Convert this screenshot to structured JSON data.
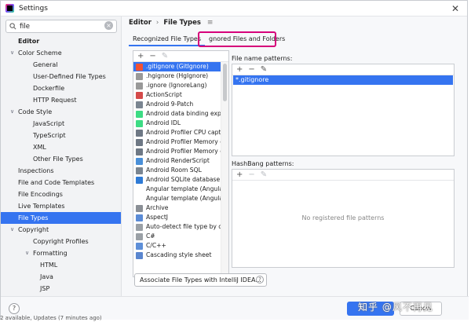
{
  "window": {
    "title": "Settings"
  },
  "search": {
    "value": "file"
  },
  "sidebar": {
    "items": [
      {
        "label": "Editor",
        "depth": 0,
        "bold": true,
        "chevron": ""
      },
      {
        "label": "Color Scheme",
        "depth": 1,
        "chevron": "∨"
      },
      {
        "label": "General",
        "depth": 2,
        "chevron": ""
      },
      {
        "label": "User-Defined File Types",
        "depth": 2,
        "chevron": ""
      },
      {
        "label": "Dockerfile",
        "depth": 2,
        "chevron": ""
      },
      {
        "label": "HTTP Request",
        "depth": 2,
        "chevron": ""
      },
      {
        "label": "Code Style",
        "depth": 1,
        "chevron": "∨"
      },
      {
        "label": "JavaScript",
        "depth": 2,
        "chevron": ""
      },
      {
        "label": "TypeScript",
        "depth": 2,
        "chevron": ""
      },
      {
        "label": "XML",
        "depth": 2,
        "chevron": ""
      },
      {
        "label": "Other File Types",
        "depth": 2,
        "chevron": ""
      },
      {
        "label": "Inspections",
        "depth": 1,
        "chevron": ""
      },
      {
        "label": "File and Code Templates",
        "depth": 1,
        "chevron": ""
      },
      {
        "label": "File Encodings",
        "depth": 1,
        "chevron": ""
      },
      {
        "label": "Live Templates",
        "depth": 1,
        "chevron": ""
      },
      {
        "label": "File Types",
        "depth": 1,
        "chevron": "",
        "selected": true
      },
      {
        "label": "Copyright",
        "depth": 1,
        "chevron": "∨"
      },
      {
        "label": "Copyright Profiles",
        "depth": 2,
        "chevron": ""
      },
      {
        "label": "Formatting",
        "depth": 2,
        "chevron": "∨"
      },
      {
        "label": "HTML",
        "depth": 3,
        "chevron": ""
      },
      {
        "label": "Java",
        "depth": 3,
        "chevron": ""
      },
      {
        "label": "JSP",
        "depth": 3,
        "chevron": ""
      }
    ]
  },
  "breadcrumb": {
    "parent": "Editor",
    "separator": "›",
    "current": "File Types",
    "menu_icon": "≡"
  },
  "tabs": [
    {
      "label": "Recognized File Types",
      "active": true
    },
    {
      "label": "gnored Files and Folders",
      "active": false
    }
  ],
  "file_types": {
    "toolbar": {
      "add": "+",
      "remove": "−",
      "edit": "✎"
    },
    "items": [
      {
        "label": ".gitignore (GitIgnore)",
        "icon": "git-icon",
        "color": "#f05133",
        "selected": true
      },
      {
        "label": ".hgignore (HgIgnore)",
        "icon": "hg-icon",
        "color": "#999999"
      },
      {
        "label": ".ignore (IgnoreLang)",
        "icon": "ignore-icon",
        "color": "#999999"
      },
      {
        "label": "ActionScript",
        "icon": "actionscript-icon",
        "color": "#d44a4a"
      },
      {
        "label": "Android 9-Patch",
        "icon": "image-icon",
        "color": "#7a8591"
      },
      {
        "label": "Android data binding express",
        "icon": "android-icon",
        "color": "#3ddc84"
      },
      {
        "label": "Android IDL",
        "icon": "android-icon",
        "color": "#3ddc84"
      },
      {
        "label": "Android Profiler CPU capture f",
        "icon": "profiler-icon",
        "color": "#6e7885"
      },
      {
        "label": "Android Profiler Memory capt",
        "icon": "profiler-icon",
        "color": "#6e7885"
      },
      {
        "label": "Android Profiler Memory capt",
        "icon": "profiler-icon",
        "color": "#6e7885"
      },
      {
        "label": "Android RenderScript",
        "icon": "renderscript-icon",
        "color": "#4a90d9"
      },
      {
        "label": "Android Room SQL",
        "icon": "database-icon",
        "color": "#7a8591"
      },
      {
        "label": "Android SQLite database",
        "icon": "sqlite-icon",
        "color": "#2f7bd6"
      },
      {
        "label": "Angular template (Angular2H",
        "icon": "",
        "color": ""
      },
      {
        "label": "Angular template (Angular2Sv",
        "icon": "",
        "color": ""
      },
      {
        "label": "Archive",
        "icon": "archive-icon",
        "color": "#8a8f96"
      },
      {
        "label": "AspectJ",
        "icon": "aspectj-icon",
        "color": "#5a8bd6"
      },
      {
        "label": "Auto-detect file type by conte",
        "icon": "file-icon",
        "color": "#9aa0a6"
      },
      {
        "label": "C#",
        "icon": "csharp-icon",
        "color": "#9aa0a6"
      },
      {
        "label": "C/C++",
        "icon": "cpp-icon",
        "color": "#5e8fd8"
      },
      {
        "label": "Cascading style sheet",
        "icon": "css-icon",
        "color": "#5a86cf"
      }
    ]
  },
  "patterns": {
    "label": "File name patterns:",
    "toolbar": {
      "add": "+",
      "remove": "−",
      "edit": "✎"
    },
    "selected_value": "*.gitignore"
  },
  "hashbang": {
    "label": "HashBang patterns:",
    "toolbar": {
      "add": "+",
      "remove": "−",
      "edit": "✎"
    },
    "empty_text": "No registered file patterns"
  },
  "associate_button": "Associate File Types with IntelliJ IDEA...",
  "footer": {
    "help": "?",
    "cancel": "Cancel",
    "watermark": "知乎 @风不再见"
  },
  "background_text": "2 available, Updates (7 minutes ago)",
  "colors": {
    "accent": "#3574f0",
    "highlight_box": "#d6007a"
  }
}
